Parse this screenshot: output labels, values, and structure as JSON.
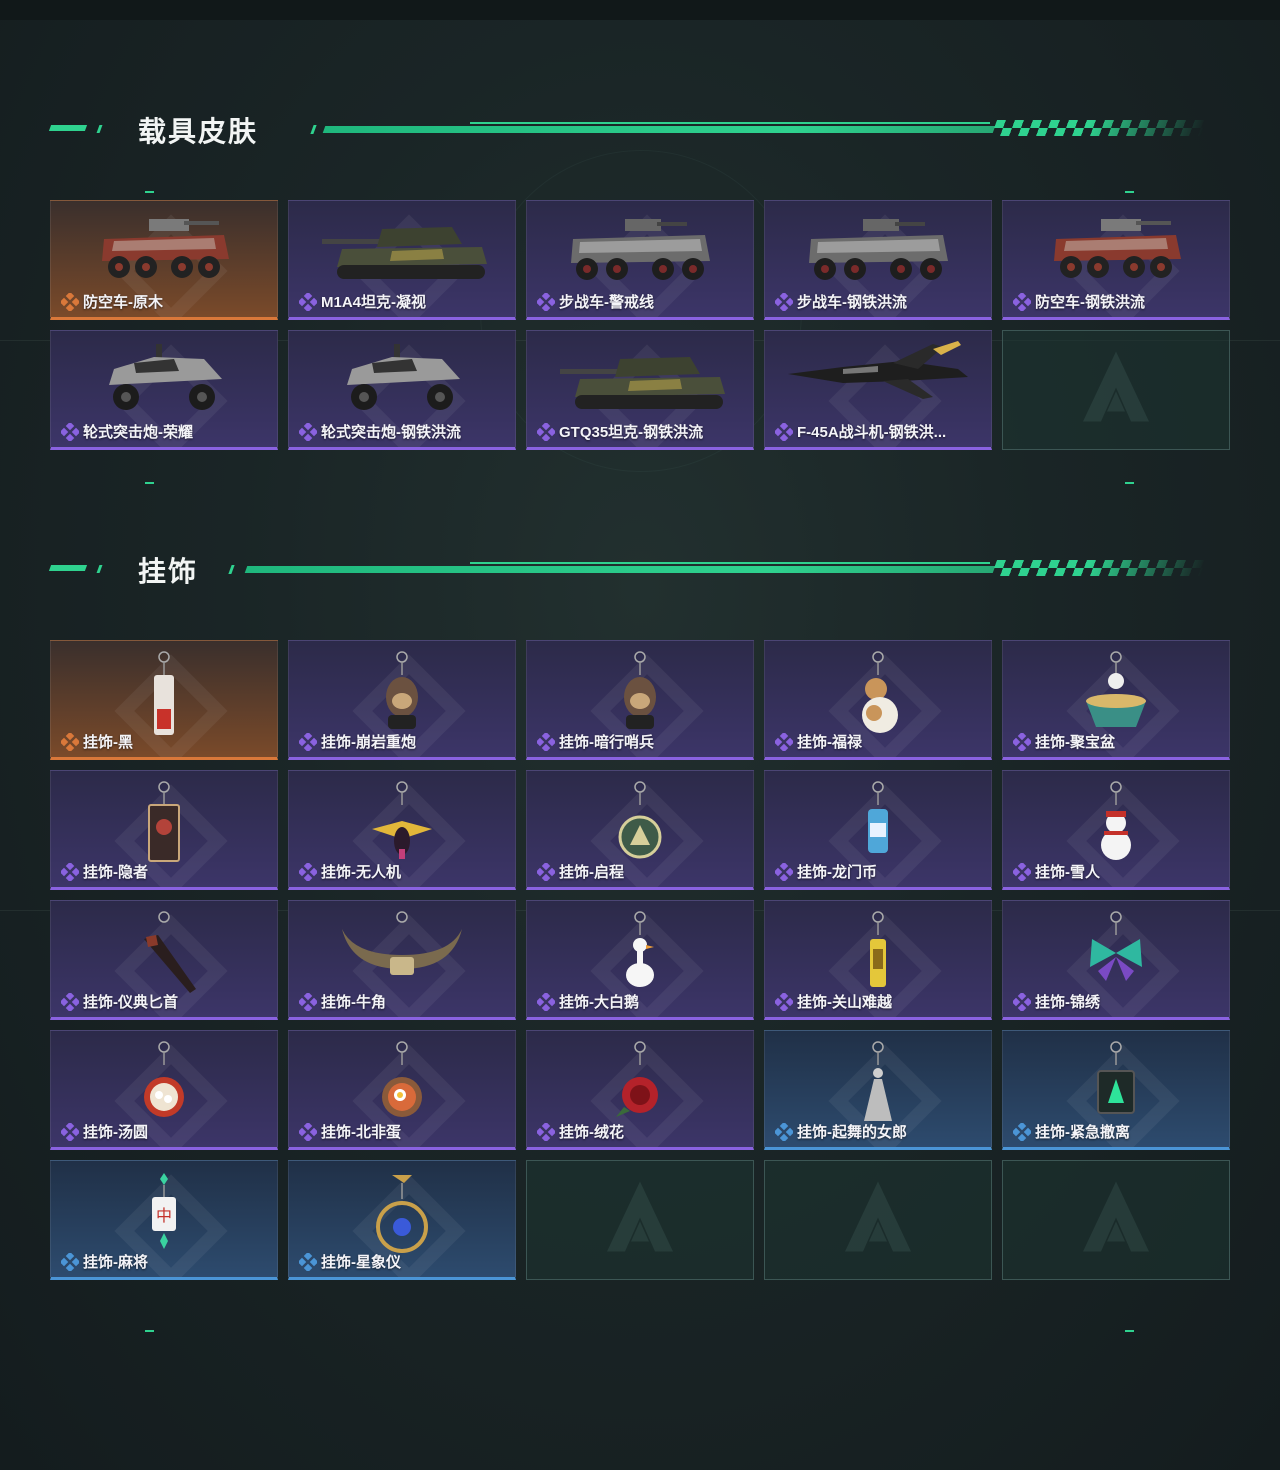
{
  "sections": {
    "vehicle": {
      "title": "载具皮肤",
      "items": [
        {
          "name": "防空车-原木",
          "rarity": "gold",
          "art": "vehicle-6wheel"
        },
        {
          "name": "M1A4坦克-凝视",
          "rarity": "purple",
          "art": "tank"
        },
        {
          "name": "步战车-警戒线",
          "rarity": "purple",
          "art": "vehicle-8wheel"
        },
        {
          "name": "步战车-钢铁洪流",
          "rarity": "purple",
          "art": "vehicle-8wheel"
        },
        {
          "name": "防空车-钢铁洪流",
          "rarity": "purple",
          "art": "vehicle-6wheel"
        },
        {
          "name": "轮式突击炮-荣耀",
          "rarity": "purple",
          "art": "buggy"
        },
        {
          "name": "轮式突击炮-钢铁洪流",
          "rarity": "purple",
          "art": "buggy"
        },
        {
          "name": "GTQ35坦克-钢铁洪流",
          "rarity": "purple",
          "art": "tank"
        },
        {
          "name": "F-45A战斗机-钢铁洪...",
          "rarity": "purple",
          "art": "jet"
        },
        {
          "name": "",
          "rarity": "empty",
          "art": "logo"
        }
      ]
    },
    "charms": {
      "title": "挂饰",
      "items": [
        {
          "name": "挂饰-黑",
          "rarity": "gold",
          "art": "tag"
        },
        {
          "name": "挂饰-崩岩重炮",
          "rarity": "purple",
          "art": "figure"
        },
        {
          "name": "挂饰-暗行哨兵",
          "rarity": "purple",
          "art": "figure"
        },
        {
          "name": "挂饰-福禄",
          "rarity": "purple",
          "art": "gourd"
        },
        {
          "name": "挂饰-聚宝盆",
          "rarity": "purple",
          "art": "bowl"
        },
        {
          "name": "挂饰-隐者",
          "rarity": "purple",
          "art": "card"
        },
        {
          "name": "挂饰-无人机",
          "rarity": "purple",
          "art": "drone"
        },
        {
          "name": "挂饰-启程",
          "rarity": "purple",
          "art": "medal"
        },
        {
          "name": "挂饰-龙门币",
          "rarity": "purple",
          "art": "can"
        },
        {
          "name": "挂饰-雪人",
          "rarity": "purple",
          "art": "snowman"
        },
        {
          "name": "挂饰-仪典匕首",
          "rarity": "purple",
          "art": "dagger"
        },
        {
          "name": "挂饰-牛角",
          "rarity": "purple",
          "art": "horns"
        },
        {
          "name": "挂饰-大白鹅",
          "rarity": "purple",
          "art": "goose"
        },
        {
          "name": "挂饰-关山难越",
          "rarity": "purple",
          "art": "bar"
        },
        {
          "name": "挂饰-锦绣",
          "rarity": "purple",
          "art": "butterfly"
        },
        {
          "name": "挂饰-汤圆",
          "rarity": "purple",
          "art": "bowl-red"
        },
        {
          "name": "挂饰-北非蛋",
          "rarity": "purple",
          "art": "bowl-egg"
        },
        {
          "name": "挂饰-绒花",
          "rarity": "purple",
          "art": "rose"
        },
        {
          "name": "挂饰-起舞的女郎",
          "rarity": "blue",
          "art": "dancer"
        },
        {
          "name": "挂饰-紧急撤离",
          "rarity": "blue",
          "art": "sign"
        },
        {
          "name": "挂饰-麻将",
          "rarity": "blue",
          "art": "mahjong"
        },
        {
          "name": "挂饰-星象仪",
          "rarity": "blue",
          "art": "orb"
        },
        {
          "name": "",
          "rarity": "empty",
          "art": "logo"
        },
        {
          "name": "",
          "rarity": "empty",
          "art": "logo"
        },
        {
          "name": "",
          "rarity": "empty",
          "art": "logo"
        }
      ]
    }
  },
  "colors": {
    "accent": "#2fd28f",
    "purple": "#8a62e0",
    "gold": "#d9783a",
    "blue": "#4b95d6"
  }
}
